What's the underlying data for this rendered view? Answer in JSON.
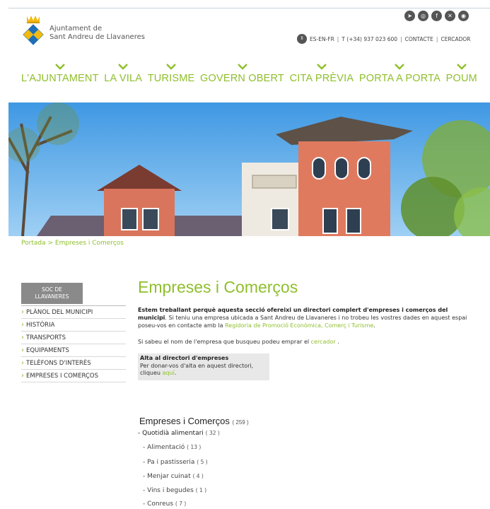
{
  "header": {
    "brand_line1": "Ajuntament de",
    "brand_line2": "Sant Andreu de Llavaneres",
    "social": [
      "telegram-icon",
      "instagram-icon",
      "facebook-icon",
      "x-icon",
      "rss-icon"
    ],
    "lang_badge": "ll",
    "languages": "ES-EN-FR",
    "phone": "T (+34) 937 023 600",
    "contact": "CONTACTE",
    "search": "CERCADOR"
  },
  "nav": {
    "items": [
      {
        "label": "L'AJUNTAMENT"
      },
      {
        "label": "LA VILA"
      },
      {
        "label": "TURISME"
      },
      {
        "label": "GOVERN OBERT"
      },
      {
        "label": "CITA PRÈVIA"
      },
      {
        "label": "PORTA A PORTA"
      },
      {
        "label": "POUM"
      }
    ]
  },
  "breadcrumb": {
    "home": "Portada",
    "sep": ">",
    "current": "Empreses i Comerços"
  },
  "sidebar": {
    "soc_line1": "SOC DE",
    "soc_line2": "LLAVANERES",
    "items": [
      {
        "label": "PLÀNOL DEL MUNICIPI"
      },
      {
        "label": "HISTÒRIA"
      },
      {
        "label": "TRANSPORTS"
      },
      {
        "label": "EQUIPAMENTS"
      },
      {
        "label": "TELÈFONS D'INTERÈS"
      },
      {
        "label": "EMPRESES I COMERÇOS"
      }
    ]
  },
  "main": {
    "title": "Empreses i Comerços",
    "intro_bold": "Estem treballant perquè aquesta secció ofereixi un directori complert d'empreses i comerços del municipi",
    "intro_rest": ". Si teniu una empresa ubicada a Sant Andreu de Llavaneres i no trobeu les vostres dades en aquest espai poseu-vos en contacte amb la ",
    "intro_link": "Regidoria de Promoció Econòmica, Comerç i Turisme",
    "intro_end": ".",
    "note_text": "Si sabeu el nom de l'empresa que busqueu podeu emprar el ",
    "note_link": "cercador",
    "note_end": " .",
    "alta_title": "Alta al directori d'empreses",
    "alta_text": "Per donar-vos d'alta en aquest directori, cliqueu ",
    "alta_link": "aquí",
    "alta_end": "."
  },
  "directory": {
    "title": "Empreses i Comerços",
    "count": "( 259 )",
    "category": {
      "label": "Quotidià alimentari",
      "count": "( 32 )"
    },
    "subs": [
      {
        "label": "Alimentació",
        "count": "( 13 )"
      },
      {
        "label": "Pa i pastisseria",
        "count": "( 5 )"
      },
      {
        "label": "Menjar cuinat",
        "count": "( 4 )"
      },
      {
        "label": "Vins i begudes",
        "count": "( 1 )"
      },
      {
        "label": "Conreus",
        "count": "( 7 )"
      }
    ]
  },
  "colors": {
    "accent": "#8fbf2c",
    "sidebar_badge": "#8a8a8a",
    "sky": "#4aa3e8",
    "facade": "#e07a5f"
  }
}
